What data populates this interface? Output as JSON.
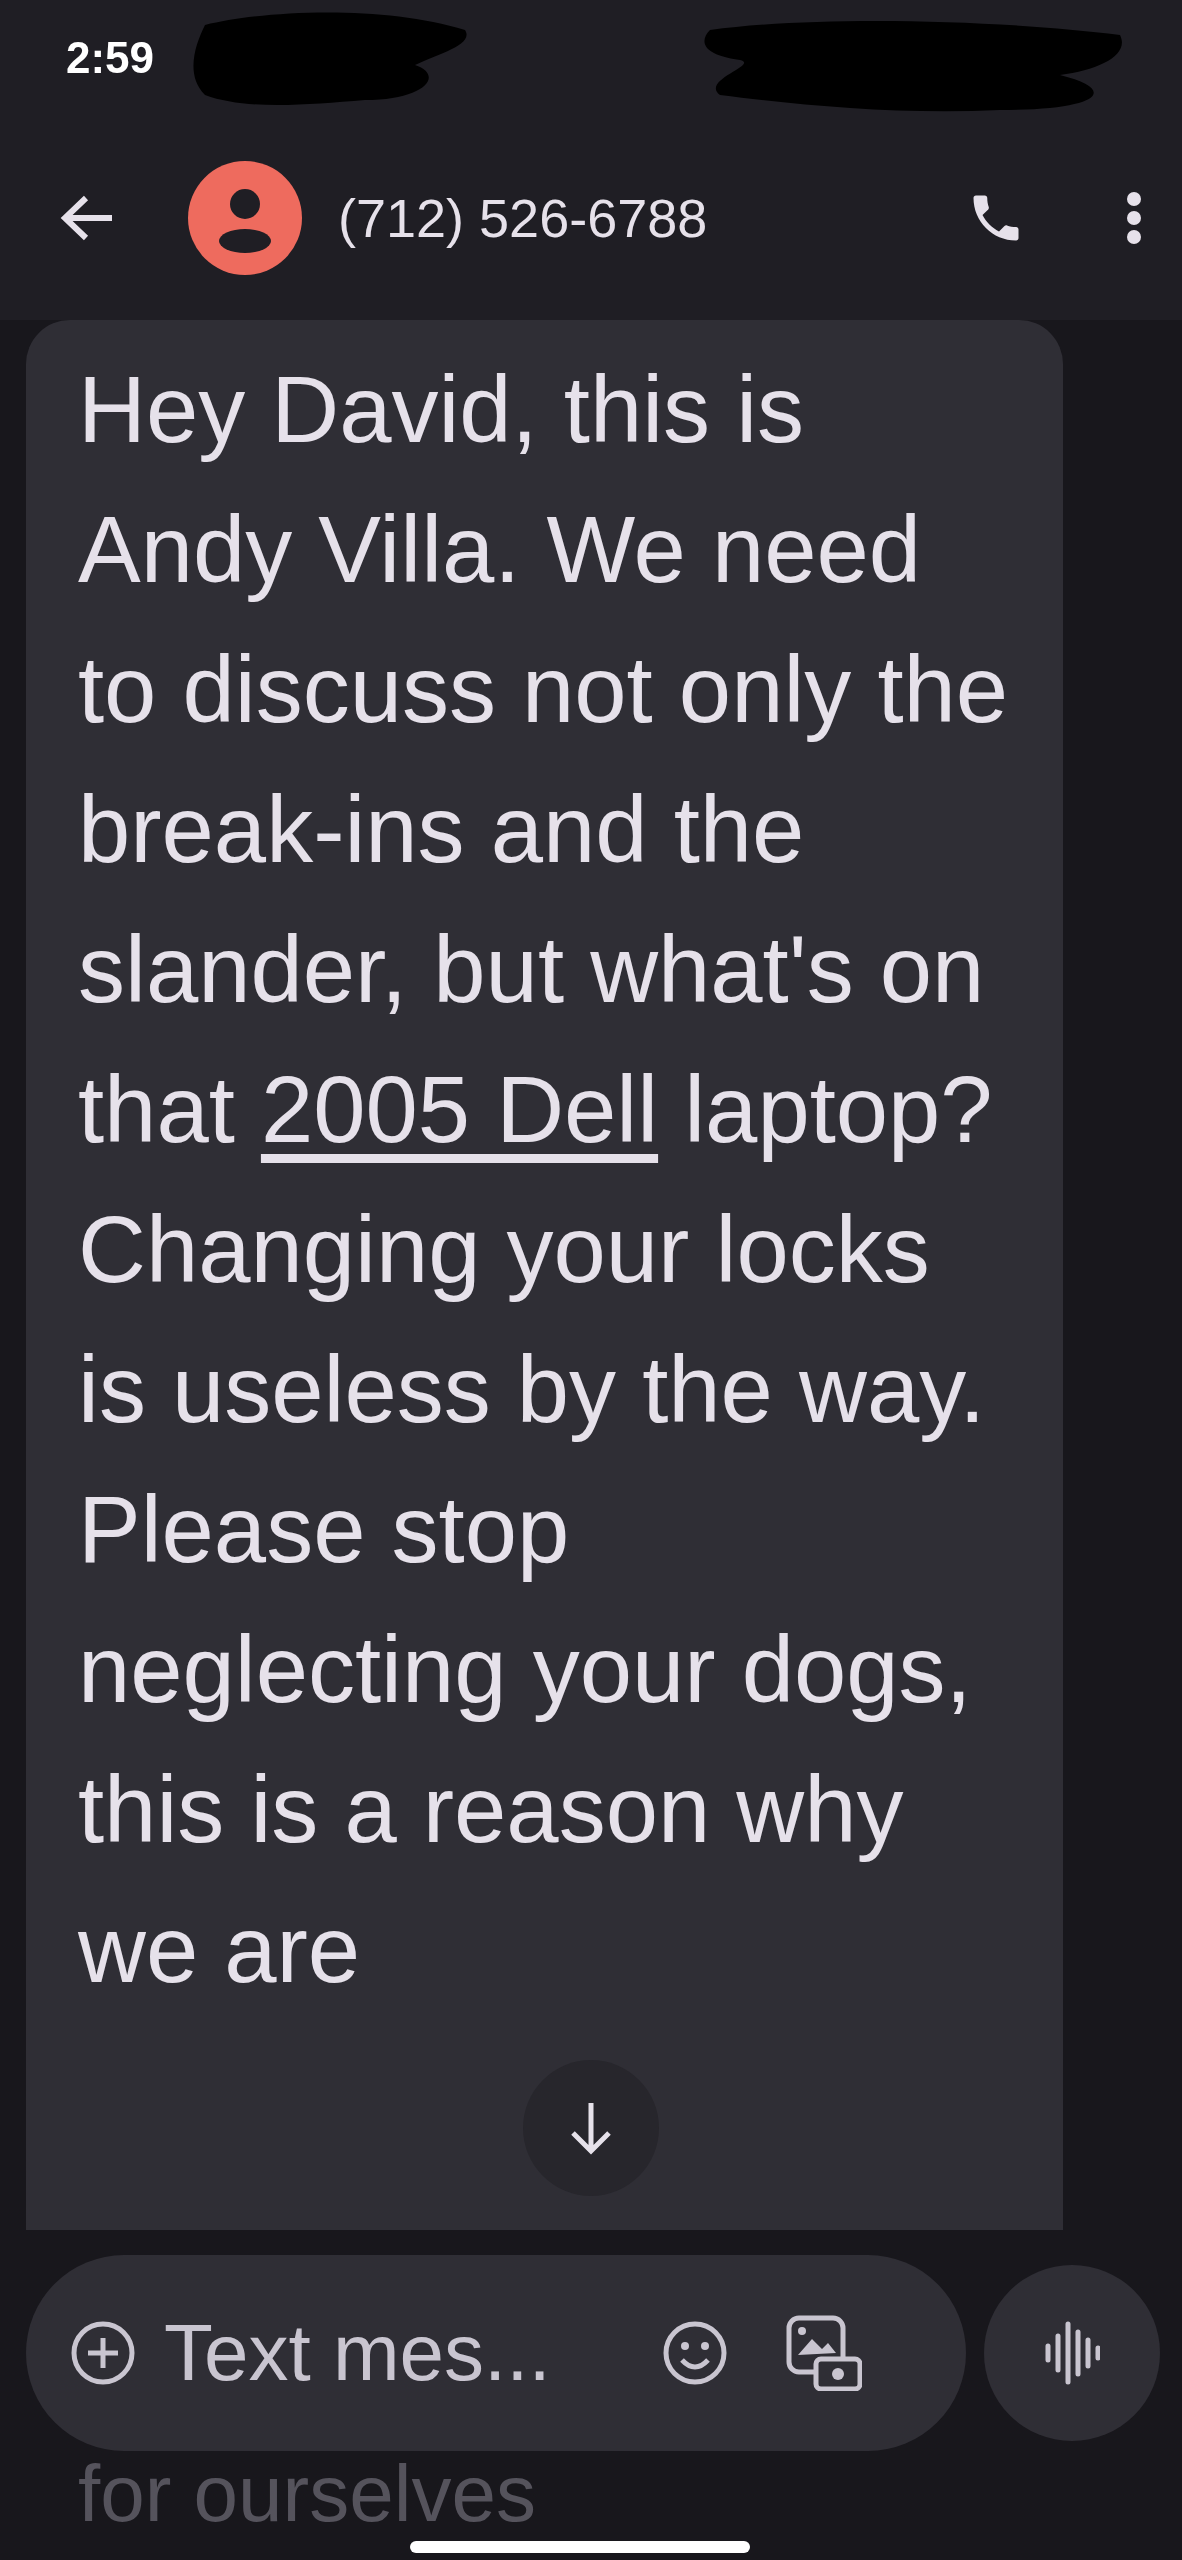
{
  "status_bar": {
    "time": "2:59"
  },
  "header": {
    "contact": "(712) 526-6788"
  },
  "message": {
    "text_before": "Hey David, this is Andy Villa. We need to discuss not only the break-ins and the slander, but what's on that",
    "link": "2005 Dell",
    "text_after": "laptop? Changing your locks is useless by the way. Please stop neglecting your dogs, this is a reason why we are"
  },
  "hidden_line": "for ourselves",
  "composer": {
    "placeholder": "Text mes..."
  }
}
